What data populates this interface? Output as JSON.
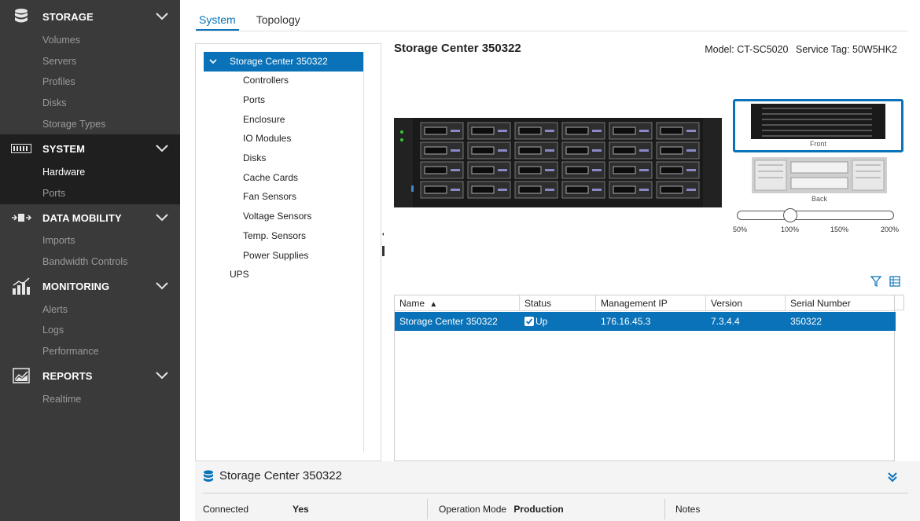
{
  "sidebar": {
    "sections": [
      {
        "label": "STORAGE",
        "icon": "database-icon",
        "items": [
          "Volumes",
          "Servers",
          "Profiles",
          "Disks",
          "Storage Types"
        ]
      },
      {
        "label": "SYSTEM",
        "icon": "server-rack-icon",
        "items": [
          "Hardware",
          "Ports"
        ]
      },
      {
        "label": "DATA MOBILITY",
        "icon": "data-transfer-icon",
        "items": [
          "Imports",
          "Bandwidth Controls"
        ]
      },
      {
        "label": "MONITORING",
        "icon": "bar-chart-icon",
        "items": [
          "Alerts",
          "Logs",
          "Performance"
        ]
      },
      {
        "label": "REPORTS",
        "icon": "report-chart-icon",
        "items": [
          "Realtime"
        ]
      }
    ],
    "active_item": "Hardware"
  },
  "tabs": [
    "System",
    "Topology"
  ],
  "active_tab": "System",
  "tree": {
    "root": "Storage Center 350322",
    "children": [
      "Controllers",
      "Ports",
      "Enclosure",
      "IO Modules",
      "Disks",
      "Cache Cards",
      "Fan Sensors",
      "Voltage Sensors",
      "Temp. Sensors",
      "Power Supplies"
    ],
    "sibling": "UPS"
  },
  "detail": {
    "title": "Storage Center 350322",
    "model_label": "Model: CT-SC5020",
    "service_tag_label": "Service Tag: 50W5HK2",
    "front_caption": "Front",
    "back_caption": "Back",
    "zoom_labels": [
      "50%",
      "100%",
      "150%",
      "200%"
    ],
    "zoom_value_percent": 100
  },
  "table": {
    "columns": [
      "Name",
      "Status",
      "Management IP",
      "Version",
      "Serial Number"
    ],
    "sort_indicator": "▲",
    "rows": [
      {
        "name": "Storage Center 350322",
        "status": "Up",
        "ip": "176.16.45.3",
        "version": "7.3.4.4",
        "serial": "350322"
      }
    ]
  },
  "summary": {
    "title": "Storage Center 350322",
    "connected_label": "Connected",
    "connected_value": "Yes",
    "operation_mode_label": "Operation Mode",
    "operation_mode_value": "Production",
    "notes_label": "Notes"
  },
  "colors": {
    "accent": "#0a72b8",
    "sidebar_bg": "#3a3a3a",
    "sidebar_active": "#1f1f1f"
  }
}
